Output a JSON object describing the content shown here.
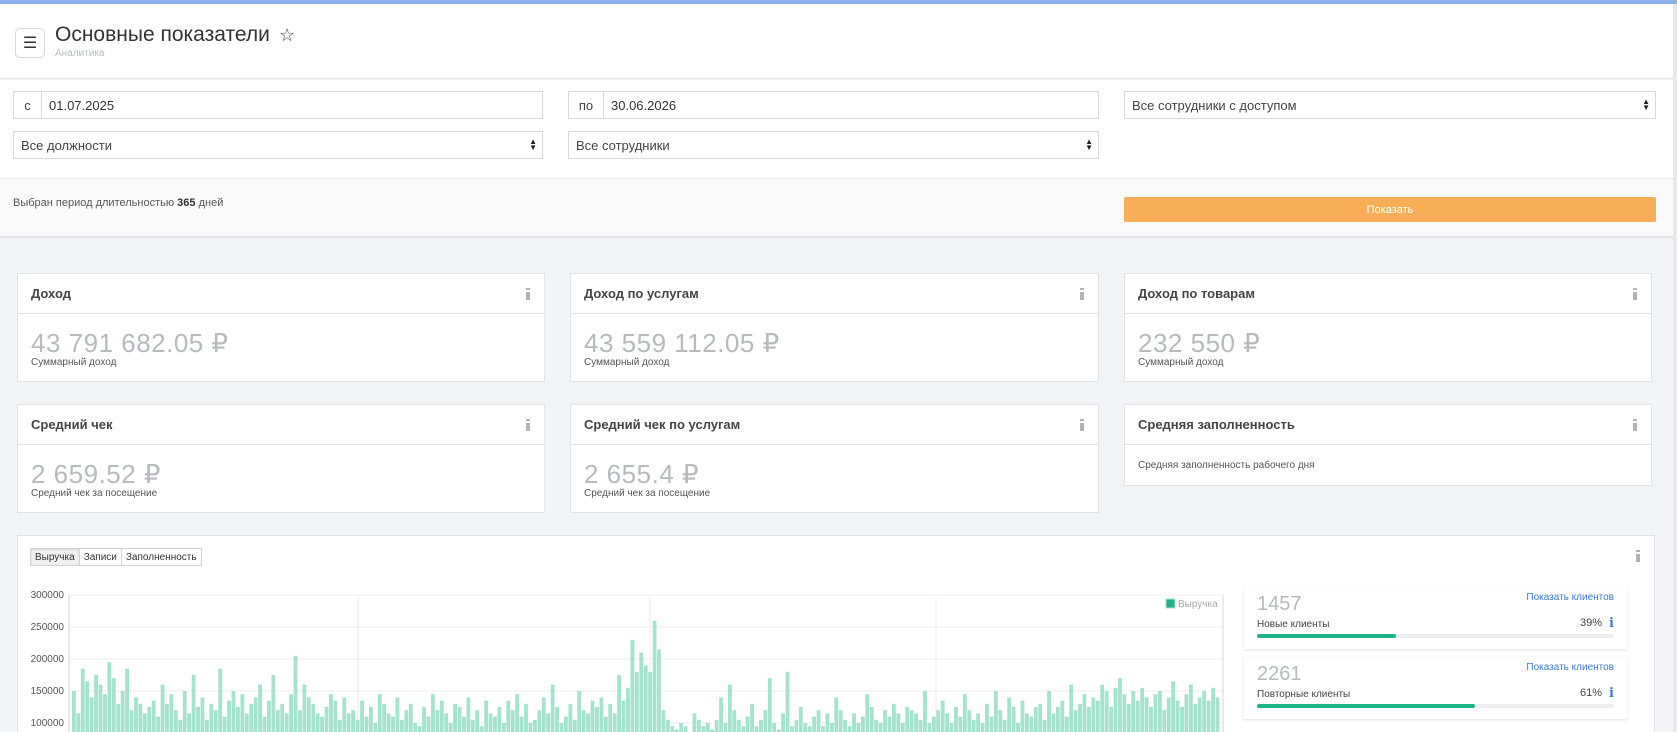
{
  "header": {
    "title": "Основные показатели",
    "breadcrumb": "Аналитика",
    "menu_icon": "hamburger-icon",
    "star_icon": "star-outline-icon"
  },
  "filters": {
    "date_from_prefix": "с",
    "date_from": "01.07.2025",
    "date_to_prefix": "по",
    "date_to": "30.06.2026",
    "staff_access_select": "Все сотрудники с доступом",
    "positions_select": "Все должности",
    "staff_select": "Все сотрудники"
  },
  "period": {
    "text_before": "Выбран период длительностью",
    "days": "365",
    "text_after": "дней",
    "show_button": "Показать"
  },
  "cards": {
    "income": {
      "title": "Доход",
      "value": "43 791 682.05 ₽",
      "caption": "Суммарный доход"
    },
    "income_services": {
      "title": "Доход по услугам",
      "value": "43 559 112.05 ₽",
      "caption": "Суммарный доход"
    },
    "income_goods": {
      "title": "Доход по товарам",
      "value": "232 550 ₽",
      "caption": "Суммарный доход"
    },
    "avg_check": {
      "title": "Средний чек",
      "value": "2 659.52 ₽",
      "caption": "Средний чек за посещение"
    },
    "avg_check_services": {
      "title": "Средний чек по услугам",
      "value": "2 655.4 ₽",
      "caption": "Средний чек за посещение"
    },
    "avg_fill": {
      "title": "Средняя заполненность",
      "caption": "Средняя заполненность рабочего дня"
    }
  },
  "chart_tabs": [
    "Выручка",
    "Записи",
    "Заполненность"
  ],
  "chart_data": {
    "type": "bar",
    "title": "",
    "legend": [
      "Выручка"
    ],
    "legend_position": "top-right",
    "ylim": [
      0,
      300000
    ],
    "yticks": [
      "300000",
      "250000",
      "200000",
      "150000",
      "100000"
    ],
    "grid": true,
    "series": [
      {
        "name": "Выручка",
        "color": "#a6e3cf",
        "values": [
          150000,
          115000,
          185000,
          165000,
          140000,
          175000,
          160000,
          145000,
          195000,
          170000,
          130000,
          150000,
          185000,
          120000,
          140000,
          130000,
          115000,
          125000,
          135000,
          110000,
          160000,
          130000,
          145000,
          120000,
          105000,
          150000,
          115000,
          175000,
          125000,
          140000,
          105000,
          130000,
          120000,
          185000,
          110000,
          135000,
          150000,
          125000,
          145000,
          115000,
          130000,
          140000,
          160000,
          110000,
          135000,
          175000,
          120000,
          130000,
          115000,
          145000,
          205000,
          120000,
          160000,
          140000,
          130000,
          115000,
          110000,
          125000,
          145000,
          135000,
          105000,
          140000,
          115000,
          120000,
          105000,
          135000,
          110000,
          125000,
          100000,
          145000,
          130000,
          115000,
          110000,
          140000,
          105000,
          120000,
          130000,
          100000,
          95000,
          125000,
          110000,
          145000,
          120000,
          135000,
          115000,
          100000,
          130000,
          125000,
          110000,
          140000,
          105000,
          120000,
          95000,
          135000,
          115000,
          110000,
          125000,
          100000,
          135000,
          120000,
          145000,
          110000,
          130000,
          100000,
          105000,
          120000,
          140000,
          115000,
          160000,
          125000,
          100000,
          110000,
          130000,
          105000,
          150000,
          120000,
          115000,
          135000,
          125000,
          140000,
          110000,
          130000,
          115000,
          175000,
          135000,
          155000,
          230000,
          180000,
          210000,
          190000,
          180000,
          260000,
          215000,
          120000,
          105000,
          95000,
          90000,
          100000,
          95000,
          85000,
          115000,
          105000,
          95000,
          100000,
          90000,
          105000,
          140000,
          100000,
          160000,
          120000,
          105000,
          95000,
          110000,
          130000,
          95000,
          105000,
          120000,
          170000,
          100000,
          90000,
          115000,
          180000,
          95000,
          105000,
          125000,
          100000,
          95000,
          110000,
          120000,
          95000,
          115000,
          100000,
          140000,
          120000,
          105000,
          95000,
          115000,
          100000,
          110000,
          145000,
          125000,
          105000,
          100000,
          120000,
          110000,
          130000,
          115000,
          100000,
          125000,
          120000,
          115000,
          105000,
          150000,
          100000,
          110000,
          120000,
          135000,
          115000,
          100000,
          125000,
          110000,
          145000,
          120000,
          105000,
          115000,
          100000,
          130000,
          110000,
          150000,
          120000,
          105000,
          140000,
          125000,
          100000,
          135000,
          115000,
          110000,
          125000,
          130000,
          105000,
          150000,
          115000,
          125000,
          135000,
          110000,
          160000,
          120000,
          130000,
          145000,
          125000,
          140000,
          135000,
          160000,
          150000,
          125000,
          155000,
          170000,
          145000,
          130000,
          150000,
          135000,
          155000,
          140000,
          125000,
          145000,
          150000,
          120000,
          140000,
          165000,
          135000,
          125000,
          145000,
          160000,
          130000,
          140000,
          150000,
          135000,
          155000,
          140000
        ]
      }
    ]
  },
  "stats": [
    {
      "value": "1457",
      "label": "Новые клиенты",
      "link": "Показать клиентов",
      "percent_text": "39%",
      "percent": 39
    },
    {
      "value": "2261",
      "label": "Повторные клиенты",
      "link": "Показать клиентов",
      "percent_text": "61%",
      "percent": 61
    }
  ],
  "colors": {
    "accent_button": "#f7ae57",
    "progress": "#1fb388",
    "link": "#3b7bd0",
    "bars": "#a6e3cf"
  }
}
